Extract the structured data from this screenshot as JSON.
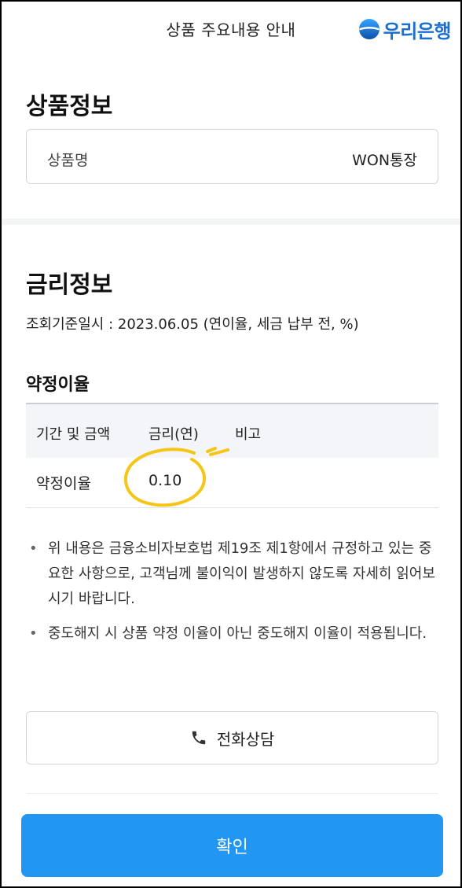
{
  "header": {
    "title": "상품 주요내용 안내",
    "bank_logo_text": "우리은행",
    "logo_color": "#1a6fd1"
  },
  "product_info": {
    "section_title": "상품정보",
    "name_label": "상품명",
    "name_value": "WON통장"
  },
  "rate_info": {
    "section_title": "금리정보",
    "base_date": "조회기준일시 : 2023.06.05 (연이율, 세금 납부 전, %)",
    "subsection_title": "약정이율",
    "table": {
      "headers": [
        "기간 및 금액",
        "금리(연)",
        "비고"
      ],
      "rows": [
        {
          "period": "약정이율",
          "rate": "0.10",
          "note": ""
        }
      ]
    }
  },
  "notes": [
    "위 내용은 금융소비자보호법 제19조 제1항에서 규정하고 있는 중요한 사항으로, 고객님께 불이익이 발생하지 않도록 자세히 읽어보시기 바랍니다.",
    "중도해지 시 상품 약정 이율이 아닌 중도해지 이율이 적용됩니다."
  ],
  "buttons": {
    "call_label": "전화상담",
    "confirm_label": "확인",
    "confirm_color": "#2196f3"
  },
  "annotation": {
    "highlight_color": "#f5c518"
  }
}
